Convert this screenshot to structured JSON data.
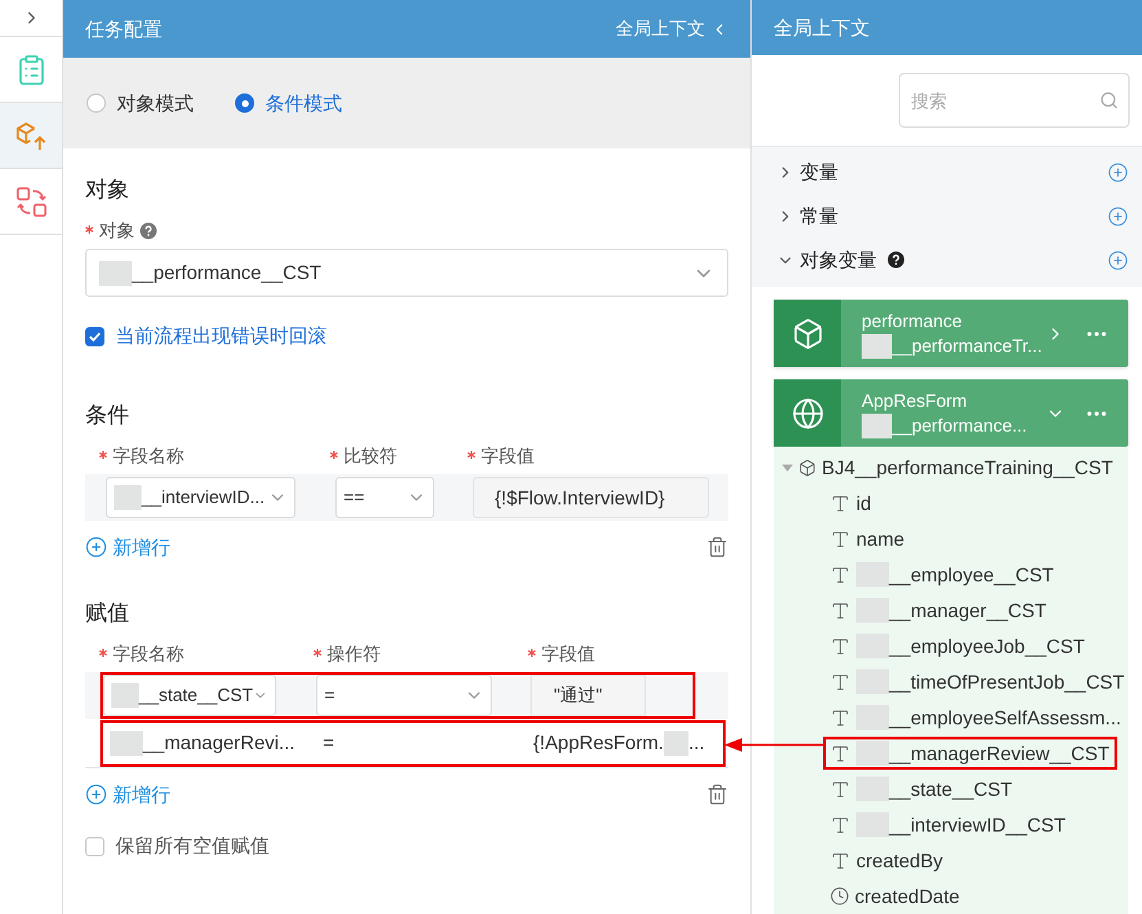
{
  "rail": {
    "items": [
      {
        "kind": "list",
        "selected": false
      },
      {
        "kind": "cube",
        "selected": true
      },
      {
        "kind": "swap",
        "selected": false
      }
    ]
  },
  "task_panel": {
    "title": "任务配置",
    "context_link": "全局上下文"
  },
  "modes": [
    {
      "label": "对象模式",
      "selected": false
    },
    {
      "label": "条件模式",
      "selected": true
    }
  ],
  "object_section": {
    "heading": "对象",
    "field_label": "对象",
    "value": "__performance__CST",
    "redacted": true,
    "rollback": {
      "label": "当前流程出现错误时回滚",
      "checked": true
    }
  },
  "conditions": {
    "heading": "条件",
    "columns": [
      "字段名称",
      "比较符",
      "字段值"
    ],
    "rows": [
      {
        "field": "__interviewID...",
        "redacted": true,
        "operator": "==",
        "value": "{!$Flow.InterviewID}"
      }
    ],
    "add_label": "新增行"
  },
  "assignments": {
    "heading": "赋值",
    "columns": [
      "字段名称",
      "操作符",
      "字段值"
    ],
    "rows": [
      {
        "kind": "edit",
        "field": "__state__CST",
        "redacted": true,
        "operator": "=",
        "value": "\"通过\"",
        "highlighted": true
      },
      {
        "kind": "display",
        "field": "__managerRevi...",
        "redacted": true,
        "operator": "=",
        "value": "{!AppResForm.",
        "value_tail": "...",
        "highlighted": true
      }
    ],
    "add_label": "新增行"
  },
  "keep_empty": {
    "label": "保留所有空值赋值",
    "checked": false
  },
  "context_panel": {
    "title": "全局上下文",
    "search_placeholder": "搜索",
    "groups": [
      {
        "label": "变量",
        "expanded": false,
        "help": false
      },
      {
        "label": "常量",
        "expanded": false,
        "help": false
      },
      {
        "label": "对象变量",
        "expanded": true,
        "help": true
      }
    ],
    "cards": [
      {
        "kind": "object",
        "name": "performance",
        "type": "__performanceTr...",
        "redacted": true,
        "expanded": false
      },
      {
        "kind": "form",
        "name": "AppResForm",
        "type": "__performance...",
        "redacted": true,
        "expanded": true
      }
    ],
    "tree": {
      "label": "BJ4__performanceTraining__CST",
      "expanded": true,
      "children": [
        {
          "kind": "text",
          "label": "id",
          "redacted": false,
          "highlighted": false
        },
        {
          "kind": "text",
          "label": "name",
          "redacted": false,
          "highlighted": false
        },
        {
          "kind": "text",
          "label": "__employee__CST",
          "redacted": true,
          "highlighted": false
        },
        {
          "kind": "text",
          "label": "__manager__CST",
          "redacted": true,
          "highlighted": false
        },
        {
          "kind": "text",
          "label": "__employeeJob__CST",
          "redacted": true,
          "highlighted": false
        },
        {
          "kind": "text",
          "label": "__timeOfPresentJob__CST",
          "redacted": true,
          "highlighted": false
        },
        {
          "kind": "text",
          "label": "__employeeSelfAssessm...",
          "redacted": true,
          "highlighted": false
        },
        {
          "kind": "text",
          "label": "__managerReview__CST",
          "redacted": true,
          "highlighted": true
        },
        {
          "kind": "text",
          "label": "__state__CST",
          "redacted": true,
          "highlighted": false
        },
        {
          "kind": "text",
          "label": "__interviewID__CST",
          "redacted": true,
          "highlighted": false
        },
        {
          "kind": "text",
          "label": "createdBy",
          "redacted": false,
          "highlighted": false
        },
        {
          "kind": "date",
          "label": "createdDate",
          "redacted": false,
          "highlighted": false
        }
      ]
    }
  }
}
